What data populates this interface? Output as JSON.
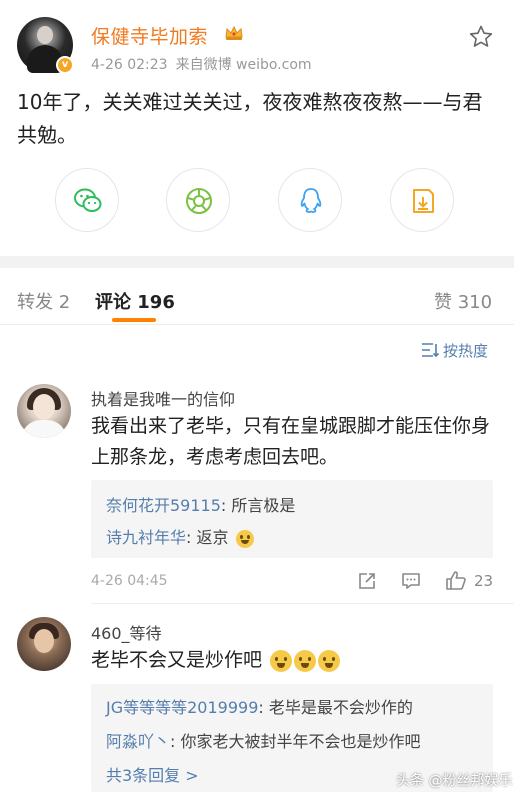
{
  "post": {
    "username": "保健寺毕加索",
    "time": "4-26 02:23",
    "source": "来自微博 weibo.com",
    "text": "10年了，关关难过关关过，夜夜难熬夜夜熬——与君共勉。"
  },
  "share": [
    "wechat-icon",
    "moments-icon",
    "qq-icon",
    "save-image-icon"
  ],
  "tabs": {
    "repost": "转发 2",
    "comment": "评论 196",
    "like": "赞 310"
  },
  "sort_label": "按热度",
  "comments": [
    {
      "name": "执着是我唯一的信仰",
      "text": "我看出来了老毕，只有在皇城跟脚才能压住你身上那条龙，考虑考虑回去吧。",
      "replies": [
        {
          "name": "奈何花开59115",
          "text": ": 所言极是"
        },
        {
          "name": "诗九衬年华",
          "text": ": 返京"
        }
      ],
      "time": "4-26 04:45",
      "likes": "23"
    },
    {
      "name": "460_等待",
      "text": "老毕不会又是炒作吧",
      "replies": [
        {
          "name": "JG等等等等2019999",
          "text": ": 老毕是最不会炒作的"
        },
        {
          "name": "阿淼吖丶",
          "text": ": 你家老大被封半年不会也是炒作吧"
        }
      ],
      "more_replies": "共3条回复 >"
    }
  ],
  "watermark": "头条 @粉丝邦娱乐",
  "colors": {
    "username": "#f27a20",
    "link": "#557ead",
    "tab_indicator": "#ff8200"
  }
}
